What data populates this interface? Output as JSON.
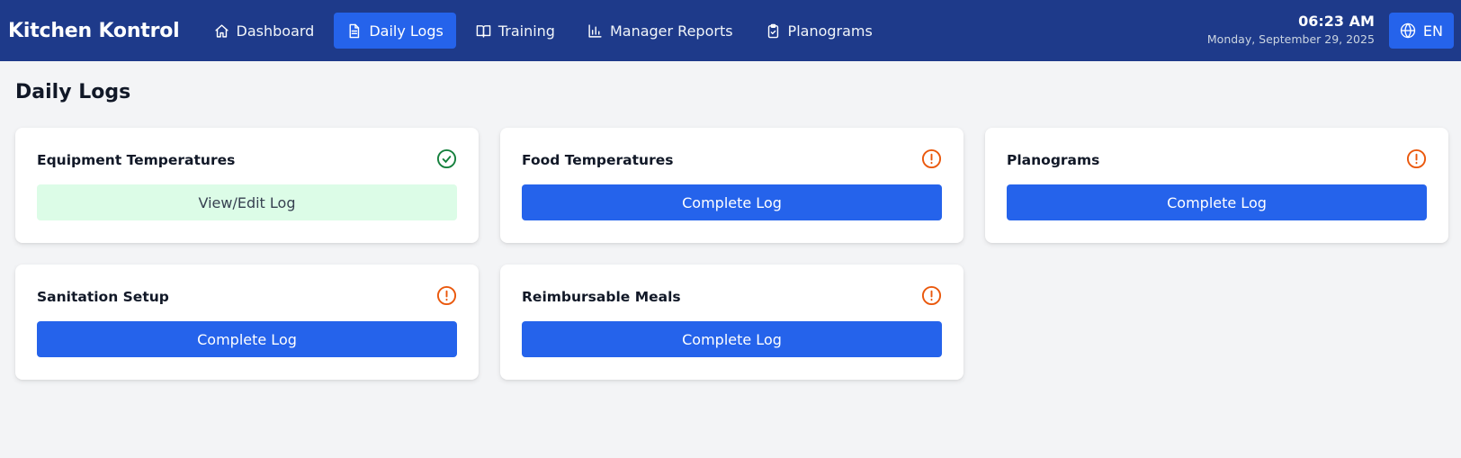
{
  "app": {
    "brand": "Kitchen Kontrol"
  },
  "nav": {
    "items": [
      {
        "label": "Dashboard",
        "icon": "home-icon",
        "active": false
      },
      {
        "label": "Daily Logs",
        "icon": "document-icon",
        "active": true
      },
      {
        "label": "Training",
        "icon": "book-icon",
        "active": false
      },
      {
        "label": "Manager Reports",
        "icon": "bar-chart-icon",
        "active": false
      },
      {
        "label": "Planograms",
        "icon": "clipboard-check-icon",
        "active": false
      }
    ]
  },
  "header": {
    "time": "06:23 AM",
    "date": "Monday, September 29, 2025",
    "language": "EN",
    "language_icon": "globe-icon"
  },
  "main": {
    "title": "Daily Logs",
    "cards": [
      {
        "title": "Equipment Temperatures",
        "status": "complete",
        "status_icon": "check-circle-icon",
        "button": "View/Edit Log"
      },
      {
        "title": "Food Temperatures",
        "status": "pending",
        "status_icon": "alert-circle-icon",
        "button": "Complete Log"
      },
      {
        "title": "Planograms",
        "status": "pending",
        "status_icon": "alert-circle-icon",
        "button": "Complete Log"
      },
      {
        "title": "Sanitation Setup",
        "status": "pending",
        "status_icon": "alert-circle-icon",
        "button": "Complete Log"
      },
      {
        "title": "Reimbursable Meals",
        "status": "pending",
        "status_icon": "alert-circle-icon",
        "button": "Complete Log"
      }
    ]
  },
  "colors": {
    "header_bg": "#1e3a8a",
    "accent": "#2563eb",
    "complete_bg": "#dcfce7",
    "complete_icon": "#15803d",
    "pending_icon": "#ea580c"
  }
}
